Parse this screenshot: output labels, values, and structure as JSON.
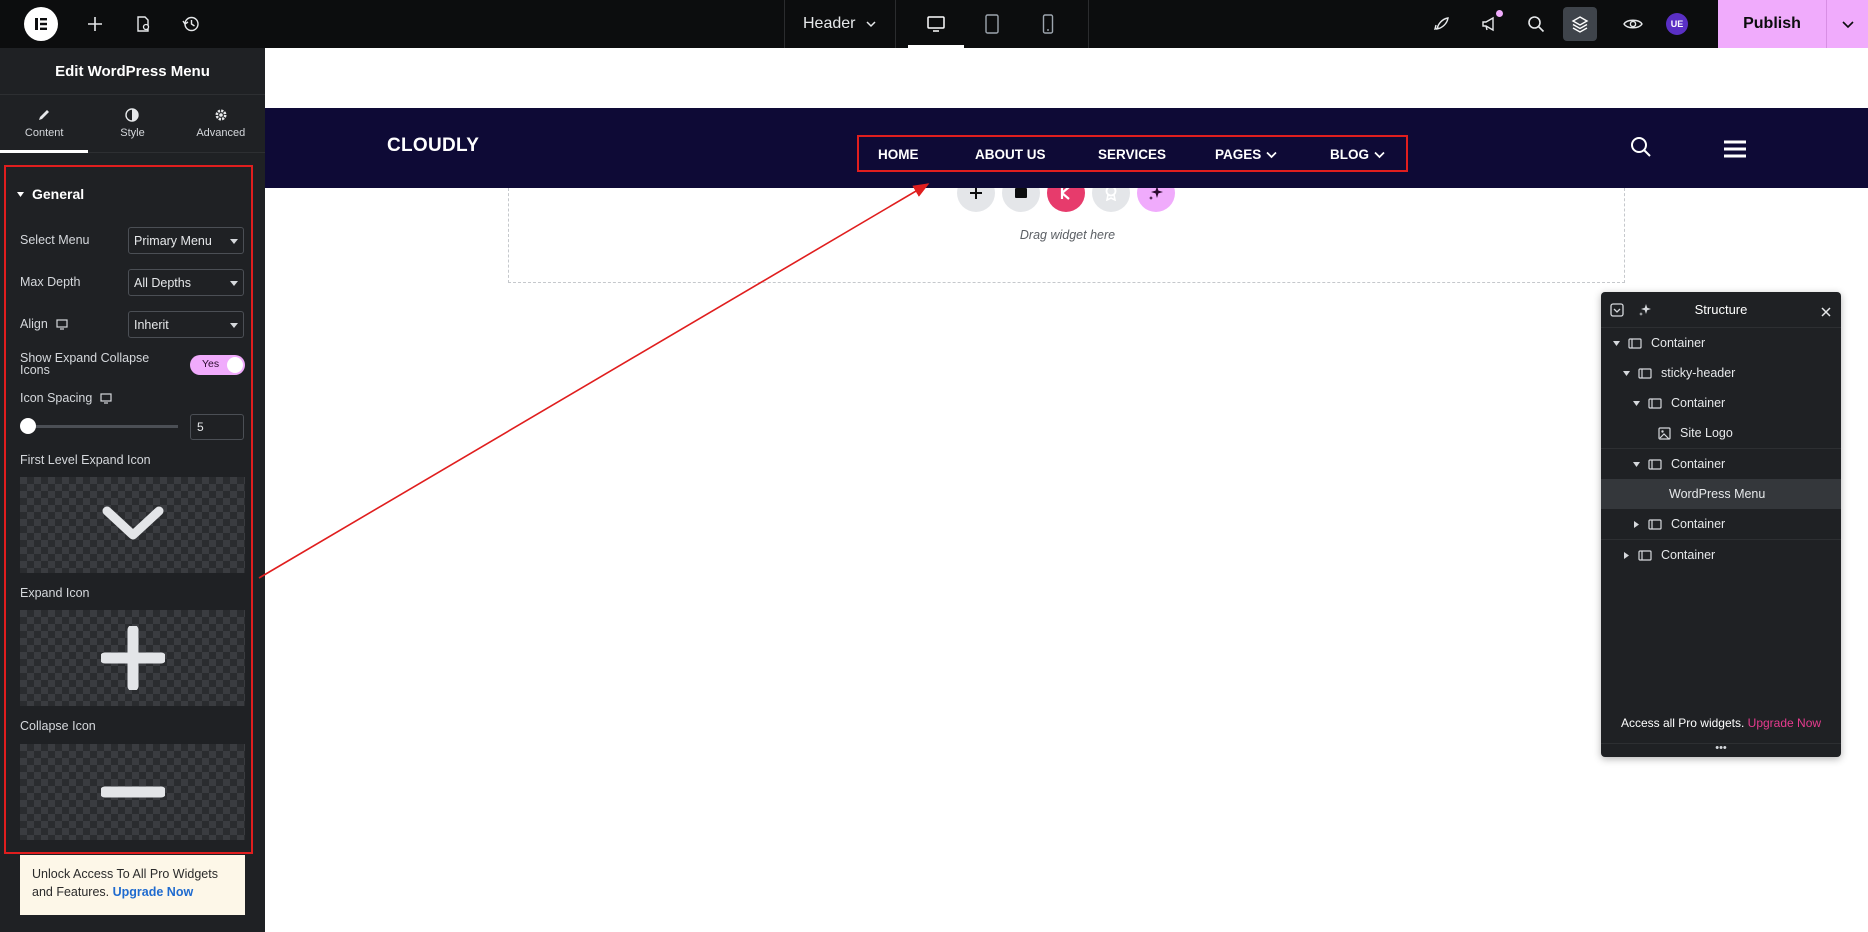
{
  "topbar": {
    "document_title": "Header",
    "publish_label": "Publish",
    "avatar_initials": "UE"
  },
  "panel": {
    "title": "Edit WordPress Menu",
    "tabs": [
      {
        "label": "Content",
        "icon": "pencil-icon",
        "active": true
      },
      {
        "label": "Style",
        "icon": "contrast-icon",
        "active": false
      },
      {
        "label": "Advanced",
        "icon": "gear-icon",
        "active": false
      }
    ],
    "section_title": "General",
    "select_menu": {
      "label": "Select Menu",
      "value": "Primary Menu"
    },
    "max_depth": {
      "label": "Max Depth",
      "value": "All Depths"
    },
    "align": {
      "label": "Align",
      "value": "Inherit"
    },
    "show_expand": {
      "label": "Show Expand Collapse Icons",
      "value": "Yes"
    },
    "icon_spacing": {
      "label": "Icon Spacing",
      "value": "5",
      "slider_fraction": 0.0
    },
    "first_level_icon_label": "First Level Expand Icon",
    "expand_icon_label": "Expand Icon",
    "collapse_icon_label": "Collapse Icon",
    "promo_text": "Unlock Access To All Pro Widgets and Features.",
    "promo_link": "Upgrade Now"
  },
  "canvas": {
    "site_logo": "CLOUDLY",
    "menu": [
      {
        "label": "HOME",
        "has_dropdown": false
      },
      {
        "label": "ABOUT US",
        "has_dropdown": false
      },
      {
        "label": "SERVICES",
        "has_dropdown": false
      },
      {
        "label": "PAGES",
        "has_dropdown": true
      },
      {
        "label": "BLOG",
        "has_dropdown": true
      }
    ],
    "drop_zone_text": "Drag widget here",
    "colors": {
      "header_bg": "#0e0a36",
      "annotation": "#e01e1e",
      "accent_pink": "#f0abfc",
      "kit_pink": "#e73b6c"
    }
  },
  "structure": {
    "title": "Structure",
    "rows": [
      {
        "label": "Container",
        "depth": 0,
        "expanded": true
      },
      {
        "label": "sticky-header",
        "depth": 1,
        "expanded": true
      },
      {
        "label": "Container",
        "depth": 2,
        "expanded": true
      },
      {
        "label": "Site Logo",
        "depth": 3
      },
      {
        "label": "Container",
        "depth": 2,
        "expanded": true
      },
      {
        "label": "WordPress Menu",
        "depth": 3,
        "selected": true
      },
      {
        "label": "Container",
        "depth": 2,
        "expanded": false
      },
      {
        "label": "Container",
        "depth": 1,
        "expanded": false
      }
    ],
    "footer_text": "Access all Pro widgets.",
    "footer_link": "Upgrade Now"
  }
}
